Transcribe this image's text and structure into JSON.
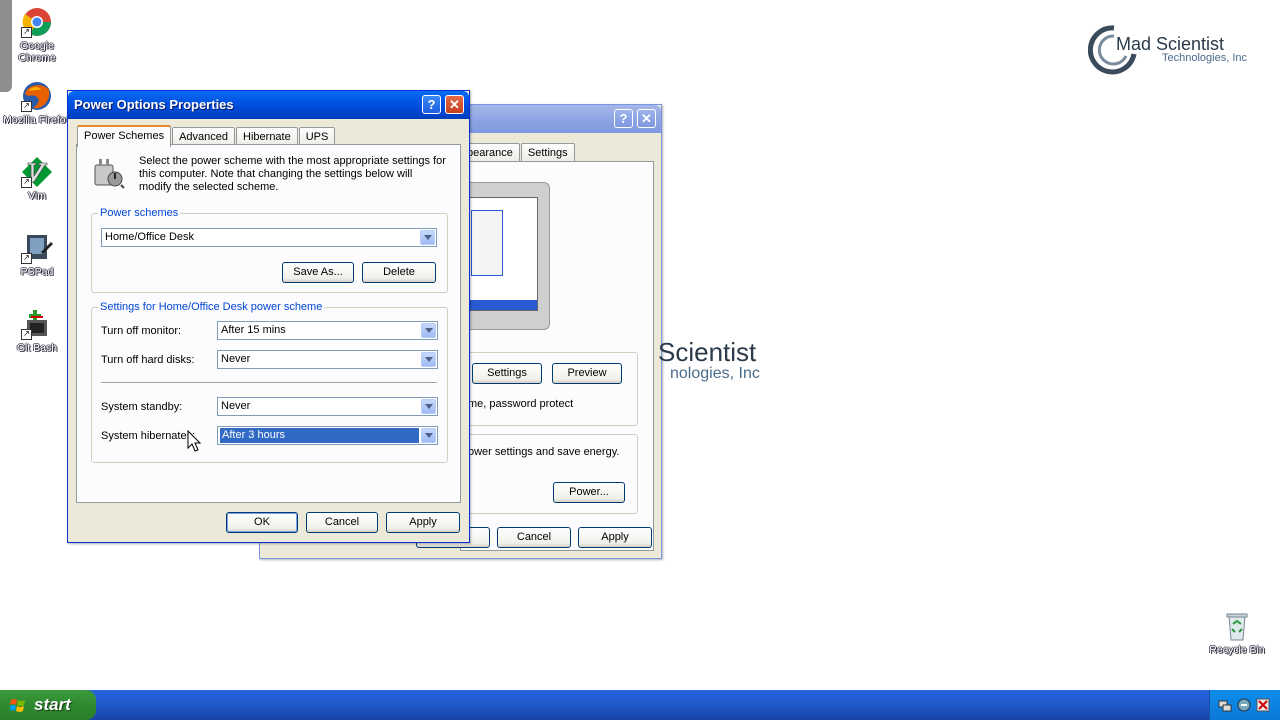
{
  "desktop": {
    "icons": [
      {
        "label": "Google Chrome",
        "icon": "chrome-icon"
      },
      {
        "label": "Mozilla Firefox",
        "icon": "firefox-icon"
      },
      {
        "label": "Vim",
        "icon": "vim-icon"
      },
      {
        "label": "PSPad",
        "icon": "pspad-icon"
      },
      {
        "label": "Git Bash",
        "icon": "git-bash-icon"
      },
      {
        "label": "Recycle Bin",
        "icon": "recycle-bin-icon"
      }
    ],
    "logo": {
      "title": "Mad Scientist",
      "subtitle": "Technologies, Inc"
    },
    "wallpaper_text": {
      "title": "Scientist",
      "subtitle": "nologies, Inc"
    }
  },
  "display_dialog": {
    "tabs": [
      "pearance",
      "Settings"
    ],
    "settings_button": "Settings",
    "preview_button": "Preview",
    "screensaver_text": "me, password protect",
    "power_text": "ower settings and save energy.",
    "power_button": "Power...",
    "cancel_button": "Cancel",
    "apply_button": "Apply"
  },
  "power_dialog": {
    "title": "Power Options Properties",
    "help_button": "?",
    "close_button": "✕",
    "tabs": [
      "Power Schemes",
      "Advanced",
      "Hibernate",
      "UPS"
    ],
    "active_tab": "Power Schemes",
    "description": "Select the power scheme with the most appropriate settings for this computer. Note that changing the settings below will modify the selected scheme.",
    "schemes_group": {
      "legend": "Power schemes",
      "selected": "Home/Office Desk",
      "save_as": "Save As...",
      "delete": "Delete"
    },
    "settings_group": {
      "legend": "Settings for Home/Office Desk power scheme",
      "monitor_label": "Turn off monitor:",
      "monitor_value": "After 15 mins",
      "disks_label": "Turn off hard disks:",
      "disks_value": "Never",
      "standby_label": "System standby:",
      "standby_value": "Never",
      "hibernate_label": "System hibernates:",
      "hibernate_value": "After 3 hours"
    },
    "ok_button": "OK",
    "cancel_button": "Cancel",
    "apply_button": "Apply"
  },
  "taskbar": {
    "start_label": "start"
  },
  "colors": {
    "xp_blue": "#0054e3",
    "start_green": "#2f8a2f",
    "dialog_bg": "#ece9d8",
    "group_legend": "#0046d5",
    "selection": "#316ac5"
  }
}
